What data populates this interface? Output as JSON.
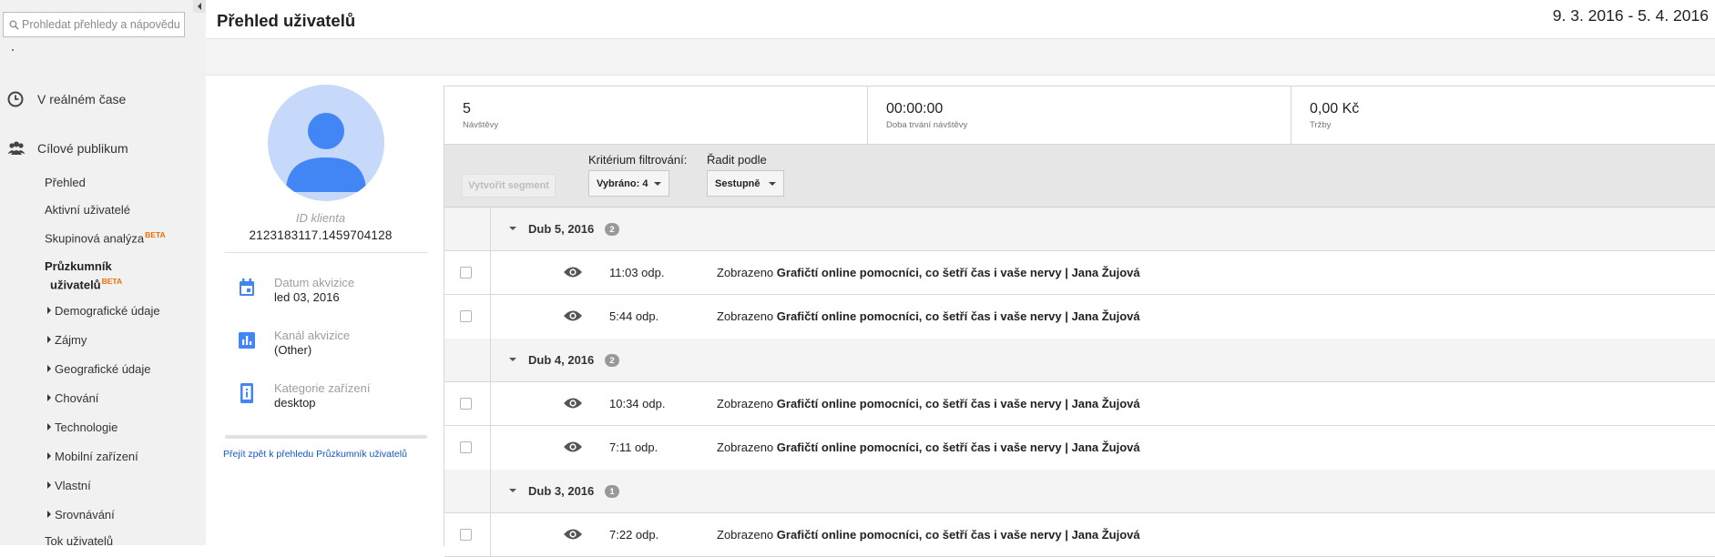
{
  "search": {
    "placeholder": "Prohledat přehledy a nápovědu"
  },
  "sidebar": {
    "realtime": "V reálném čase",
    "audience": "Cílové publikum",
    "sub": [
      "Přehled",
      "Aktivní uživatelé",
      "Skupinová analýza"
    ],
    "cohort_badge": "BETA",
    "explorer_line1": "Průzkumník",
    "explorer_line2": "uživatelů",
    "explorer_badge": "BETA",
    "sections": [
      "Demografické údaje",
      "Zájmy",
      "Geografické údaje",
      "Chování",
      "Technologie",
      "Mobilní zařízení",
      "Vlastní",
      "Srovnávání"
    ],
    "users_flow": "Tok uživatelů"
  },
  "header": {
    "title": "Přehled uživatelů",
    "date_range": "9. 3. 2016 - 5. 4. 2016"
  },
  "profile": {
    "client_id_label": "ID klienta",
    "client_id": "2123183117.1459704128",
    "attributes": [
      {
        "label": "Datum akvizice",
        "value": "led 03, 2016",
        "icon": "calendar-icon"
      },
      {
        "label": "Kanál akvizice",
        "value": "(Other)",
        "icon": "bar-chart-icon"
      },
      {
        "label": "Kategorie zařízení",
        "value": "desktop",
        "icon": "device-icon"
      }
    ],
    "back_link": "Přejít zpět k přehledu Průzkumník uživatelů"
  },
  "metrics": [
    {
      "value": "5",
      "label": "Návštěvy"
    },
    {
      "value": "00:00:00",
      "label": "Doba trvání návštěvy"
    },
    {
      "value": "0,00 Kč",
      "label": "Tržby"
    }
  ],
  "filters": {
    "segment_button": "Vytvořit segment",
    "filter_label": "Kritérium filtrování:",
    "filter_value": "Vybráno: 4",
    "sort_label": "Řadit podle",
    "sort_value": "Sestupně"
  },
  "activity": {
    "event_prefix": "Zobrazeno",
    "groups": [
      {
        "date": "Dub 5, 2016",
        "count": "2",
        "events": [
          {
            "time": "11:03 odp.",
            "title": "Grafičtí online pomocníci, co šetří čas i vaše nervy | Jana Žujová"
          },
          {
            "time": "5:44 odp.",
            "title": "Grafičtí online pomocníci, co šetří čas i vaše nervy | Jana Žujová"
          }
        ]
      },
      {
        "date": "Dub 4, 2016",
        "count": "2",
        "events": [
          {
            "time": "10:34 odp.",
            "title": "Grafičtí online pomocníci, co šetří čas i vaše nervy | Jana Žujová"
          },
          {
            "time": "7:11 odp.",
            "title": "Grafičtí online pomocníci, co šetří čas i vaše nervy | Jana Žujová"
          }
        ]
      },
      {
        "date": "Dub 3, 2016",
        "count": "1",
        "events": [
          {
            "time": "7:22 odp.",
            "title": "Grafičtí online pomocníci, co šetří čas i vaše nervy | Jana Žujová"
          }
        ]
      }
    ]
  },
  "colors": {
    "accent_blue": "#4285f4",
    "avatar_bg": "#c6d9fa",
    "beta_orange": "#e8710a",
    "link_blue": "#1155cc"
  }
}
